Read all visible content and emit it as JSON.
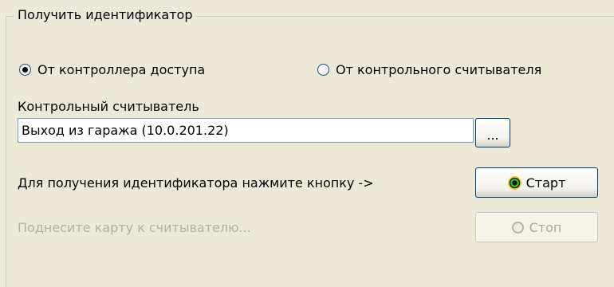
{
  "group": {
    "title": "Получить идентификатор"
  },
  "source": {
    "option_controller": "От контроллера доступа",
    "option_reader": "От контрольного считывателя",
    "selected": "controller"
  },
  "reader": {
    "label": "Контрольный считыватель",
    "value": "Выход из гаража (10.0.201.22)",
    "browse_label": "..."
  },
  "actions": {
    "instruction": "Для получения идентификатора нажмите кнопку ->",
    "start_label": "Старт",
    "start_icon": "go-icon",
    "hint": "Поднесите карту к считывателю...",
    "stop_label": "Стоп",
    "stop_icon": "stop-icon",
    "stop_enabled": false
  }
}
